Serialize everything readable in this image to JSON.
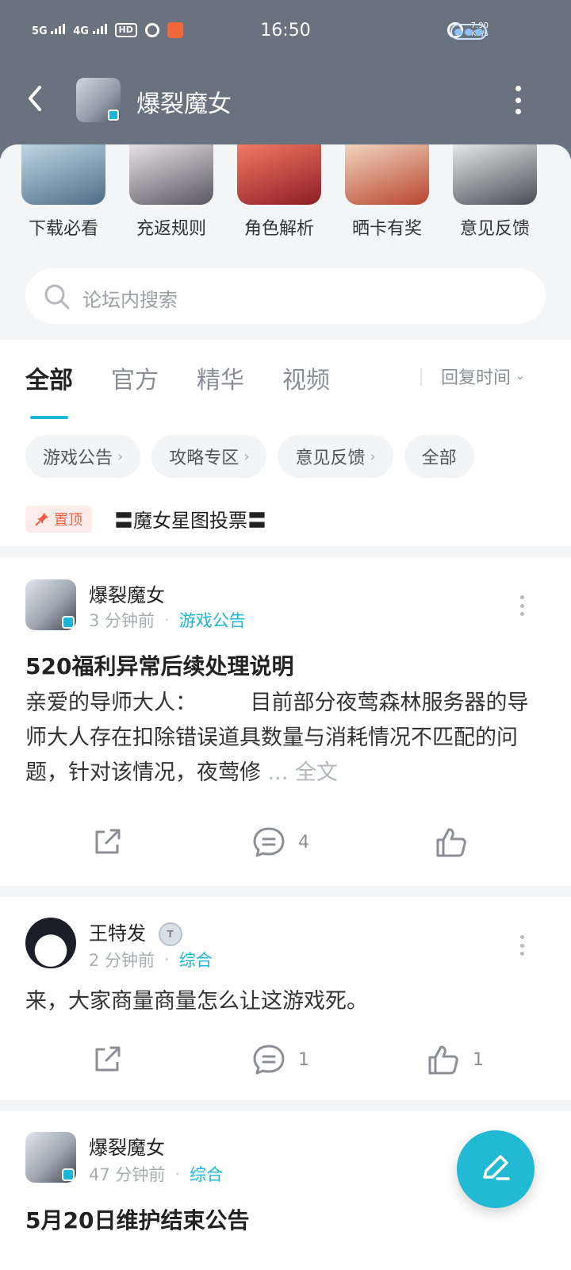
{
  "status_bar": {
    "network_1": "5G",
    "network_2": "4G",
    "hd": "HD",
    "time": "16:50",
    "speed": "7.90",
    "speed_unit": "KB/s"
  },
  "header": {
    "title": "爆裂魔女"
  },
  "shortcuts": [
    {
      "label": "下载必看",
      "color_from": "#bdd6e6",
      "color_to": "#4f6d86"
    },
    {
      "label": "充返规则",
      "color_from": "#e5e1e3",
      "color_to": "#5a5660"
    },
    {
      "label": "角色解析",
      "color_from": "#f07a63",
      "color_to": "#8d1d25"
    },
    {
      "label": "晒卡有奖",
      "color_from": "#f1d5bf",
      "color_to": "#b8452e"
    },
    {
      "label": "意见反馈",
      "color_from": "#e4e6e8",
      "color_to": "#4a4d52"
    }
  ],
  "search": {
    "placeholder": "论坛内搜索"
  },
  "tabs": [
    {
      "label": "全部",
      "active": true
    },
    {
      "label": "官方",
      "active": false
    },
    {
      "label": "精华",
      "active": false
    },
    {
      "label": "视频",
      "active": false
    }
  ],
  "sort": {
    "label": "回复时间"
  },
  "chips": [
    {
      "label": "游戏公告",
      "arrow": true
    },
    {
      "label": "攻略专区",
      "arrow": true
    },
    {
      "label": "意见反馈",
      "arrow": true
    },
    {
      "label": "全部",
      "arrow": false
    }
  ],
  "pinned": {
    "badge": "置顶",
    "title": "〓魔女星图投票〓"
  },
  "posts": [
    {
      "author": "爆裂魔女",
      "time": "3 分钟前",
      "category": "游戏公告",
      "title": "520福利异常后续处理说明",
      "excerpt": "亲爱的导师大人：　　　目前部分夜莺森林服务器的导师大人存在扣除错误道具数量与消耗情况不匹配的问题，针对该情况，夜莺修",
      "ellipsis": "...",
      "full_text": "全文",
      "comments": "4",
      "likes": ""
    },
    {
      "author": "王特发",
      "level_badge": "T",
      "time": "2 分钟前",
      "category": "综合",
      "excerpt": "来，大家商量商量怎么让这游戏死。",
      "comments": "1",
      "likes": "1"
    },
    {
      "author": "爆裂魔女",
      "time": "47 分钟前",
      "category": "综合",
      "title": "5月20日维护结束公告"
    }
  ],
  "colors": {
    "header_bg": "#69727f",
    "accent": "#1ab8d6",
    "pin": "#f06042"
  },
  "icons": {
    "back": "back-icon",
    "more": "more-icon",
    "search": "search-icon",
    "pin": "pin-icon",
    "share": "share-icon",
    "comment": "comment-icon",
    "like": "like-icon",
    "compose": "compose-icon"
  }
}
